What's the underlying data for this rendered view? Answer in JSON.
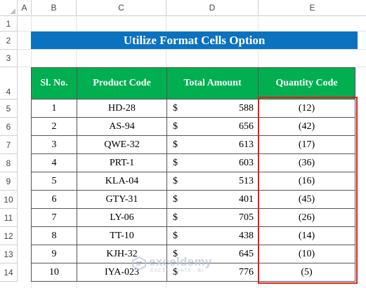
{
  "sheet": {
    "columns": [
      "A",
      "B",
      "C",
      "D",
      "E"
    ],
    "rows": [
      "1",
      "2",
      "3",
      "4",
      "5",
      "6",
      "7",
      "8",
      "9",
      "10",
      "11",
      "12",
      "13",
      "14"
    ]
  },
  "title": "Utilize Format Cells Option",
  "table": {
    "headers": [
      "Sl. No.",
      "Product Code",
      "Total Amount",
      "Quantity Code"
    ],
    "currency_symbol": "$",
    "rows": [
      {
        "sl": "1",
        "code": "HD-28",
        "amount": "588",
        "qty": "(12)"
      },
      {
        "sl": "2",
        "code": "AS-94",
        "amount": "656",
        "qty": "(42)"
      },
      {
        "sl": "3",
        "code": "QWE-32",
        "amount": "613",
        "qty": "(17)"
      },
      {
        "sl": "4",
        "code": "PRT-1",
        "amount": "603",
        "qty": "(36)"
      },
      {
        "sl": "5",
        "code": "KLA-04",
        "amount": "513",
        "qty": "(16)"
      },
      {
        "sl": "6",
        "code": "GTY-31",
        "amount": "401",
        "qty": "(45)"
      },
      {
        "sl": "7",
        "code": "LY-06",
        "amount": "705",
        "qty": "(26)"
      },
      {
        "sl": "8",
        "code": "TT-10",
        "amount": "438",
        "qty": "(14)"
      },
      {
        "sl": "9",
        "code": "KJH-32",
        "amount": "645",
        "qty": "(10)"
      },
      {
        "sl": "10",
        "code": "IYA-023",
        "amount": "776",
        "qty": "(5)"
      }
    ]
  },
  "watermark": {
    "name": "exceldemy",
    "tagline": "EXCEL · DATA · BI"
  },
  "colors": {
    "title_bg": "#0b72c0",
    "header_bg": "#00b050",
    "highlight": "#e01e1e"
  }
}
